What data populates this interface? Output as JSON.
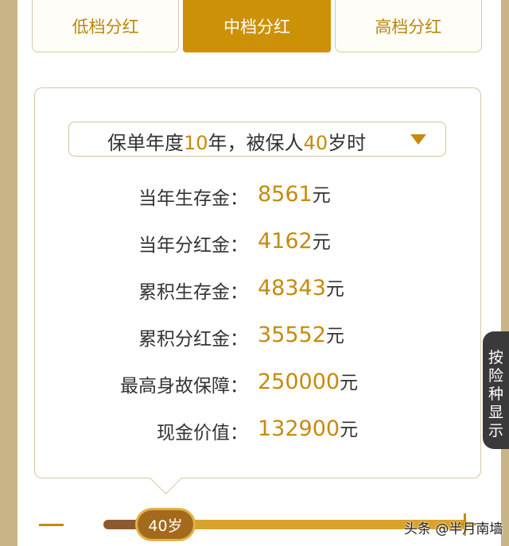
{
  "tabs": [
    {
      "label": "低档分红",
      "active": false
    },
    {
      "label": "中档分红",
      "active": true
    },
    {
      "label": "高档分红",
      "active": false
    }
  ],
  "selector": {
    "prefix": "保单年度",
    "year": "10",
    "middle": "年，被保人",
    "age": "40",
    "suffix": "岁时"
  },
  "rows": [
    {
      "label": "当年生存金：",
      "value": "8561",
      "unit": "元"
    },
    {
      "label": "当年分红金：",
      "value": "4162",
      "unit": "元"
    },
    {
      "label": "累积生存金：",
      "value": "48343",
      "unit": "元"
    },
    {
      "label": "累积分红金：",
      "value": "35552",
      "unit": "元"
    },
    {
      "label": "最高身故保障：",
      "value": "250000",
      "unit": "元"
    },
    {
      "label": "现金价值：",
      "value": "132900",
      "unit": "元"
    }
  ],
  "side_button": {
    "chars": [
      "按",
      "险",
      "种",
      "显",
      "示"
    ]
  },
  "slider": {
    "thumb_label": "40岁",
    "position_fraction": 0.17
  },
  "watermark": "头条 @半月南墙",
  "colors": {
    "accent": "#cd9108",
    "value": "#c68a0c",
    "border": "#d9c6a0",
    "side_button": "#3a3a3a"
  }
}
